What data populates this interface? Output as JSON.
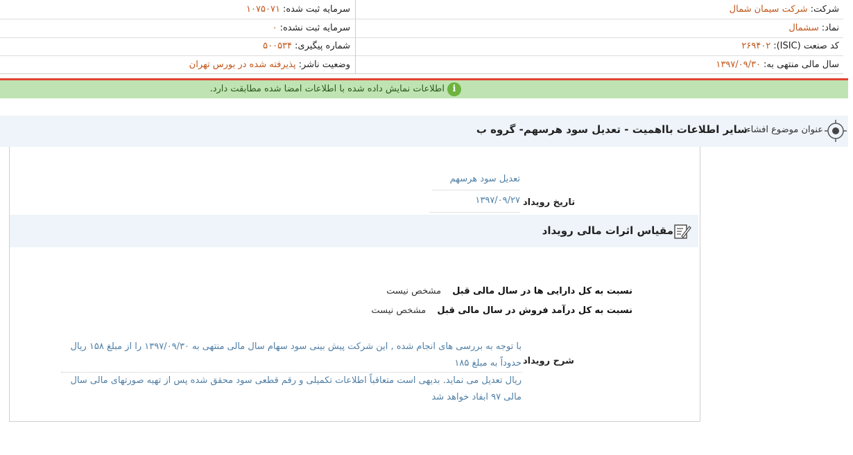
{
  "header": {
    "company_label": "شرکت:",
    "company_value": "شرکت سیمان شمال",
    "symbol_label": "نماد:",
    "symbol_value": "سشمال",
    "isic_label": "کد صنعت (ISIC):",
    "isic_value": "۲۶۹۴۰۲",
    "fiscal_label": "سال مالی منتهی به:",
    "fiscal_value": "۱۳۹۷/۰۹/۳۰",
    "reg_capital_label": "سرمایه ثبت شده:",
    "reg_capital_value": "۱۰۷۵۰۷۱",
    "unreg_capital_label": "سرمایه ثبت نشده:",
    "unreg_capital_value": "۰",
    "tracking_label": "شماره پیگیری:",
    "tracking_value": "۵۰۰۵۳۴",
    "status_label": "وضعیت ناشر:",
    "status_value": "پذیرفته شده در بورس تهران"
  },
  "notice": {
    "icon": "info-icon",
    "text": "اطلاعات نمایش داده شده با اطلاعات امضا شده مطابقت دارد."
  },
  "subject": {
    "label": "عنوان موضوع افشاء:",
    "title": "سایر اطلاعات بااهمیت - تعدیل سود هرسهم- گروه ب"
  },
  "event": {
    "type_value": "تعدیل سود هرسهم",
    "date_label": "تاریخ رویداد",
    "date_value": "۱۳۹۷/۰۹/۲۷"
  },
  "measure": {
    "title": "مقیاس اثرات مالی رویداد",
    "assets_label": "نسبت به کل دارایی ها در سال مالی قبل",
    "assets_value": "مشخص نیست",
    "revenue_label": "نسبت به کل درآمد فروش در سال مالی قبل",
    "revenue_value": "مشخص نیست"
  },
  "description": {
    "label": "شرح رویداد",
    "line1": "با توجه به بررسی های انجام شده , این شرکت پیش بینی سود سهام سال مالی منتهی به ۱۳۹۷/۰۹/۳۰ را از مبلغ ۱۵۸ ریال حدوداً به مبلغ ۱۸۵",
    "line2": "ریال تعدیل می نماید. بدیهی است متعاقباً اطلاعات تکمیلی و رقم قطعی سود محقق شده پس از تهیه صورتهای مالی سال مالی ۹۷ ابفاد خواهد شد"
  },
  "colors": {
    "value_orange": "#c0571b",
    "link_blue": "#4f7fa6",
    "notice_green": "#bfe3b2",
    "accent_red": "#e0442f"
  }
}
